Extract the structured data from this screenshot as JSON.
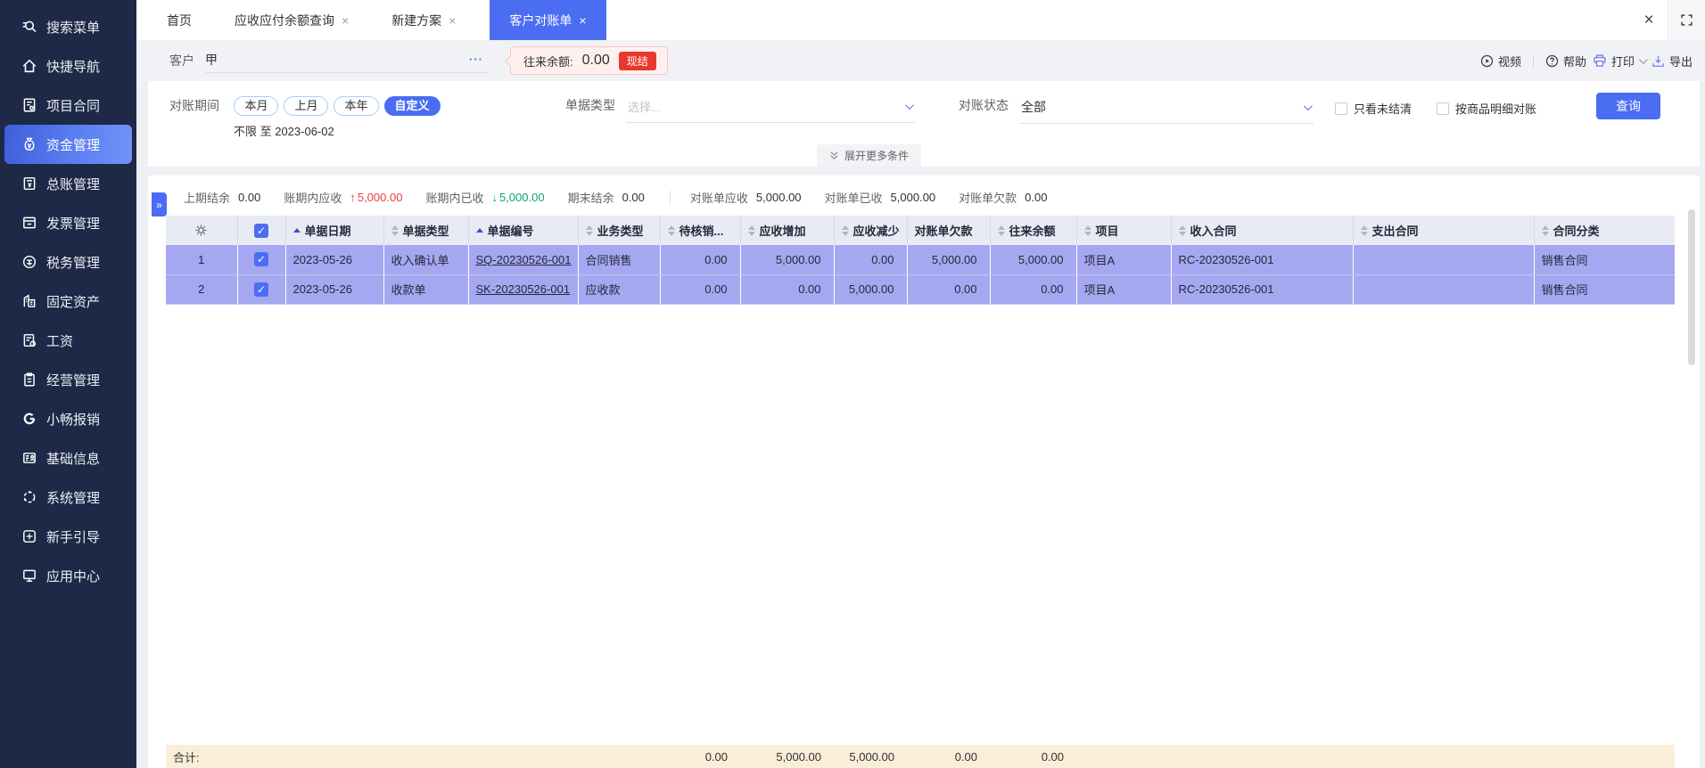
{
  "colors": {
    "accent": "#4a6df2",
    "sidebar_bg": "#1d2946",
    "row_highlight": "#a5a8f0",
    "footer_bg": "#fbeed8",
    "badge_red": "#e8382e",
    "up_red": "#f03e3e",
    "down_green": "#0ca678"
  },
  "sidebar": {
    "items": [
      {
        "label": "搜索菜单",
        "icon": "search-icon"
      },
      {
        "label": "快捷导航",
        "icon": "home-icon"
      },
      {
        "label": "项目合同",
        "icon": "project-contract-icon"
      },
      {
        "label": "资金管理",
        "icon": "funds-icon",
        "active": true
      },
      {
        "label": "总账管理",
        "icon": "ledger-icon"
      },
      {
        "label": "发票管理",
        "icon": "invoice-icon"
      },
      {
        "label": "税务管理",
        "icon": "tax-icon"
      },
      {
        "label": "固定资产",
        "icon": "fixed-assets-icon"
      },
      {
        "label": "工资",
        "icon": "payroll-icon"
      },
      {
        "label": "经营管理",
        "icon": "business-icon"
      },
      {
        "label": "小畅报销",
        "icon": "expense-icon"
      },
      {
        "label": "基础信息",
        "icon": "base-info-icon"
      },
      {
        "label": "系统管理",
        "icon": "system-icon"
      },
      {
        "label": "新手引导",
        "icon": "guide-icon"
      },
      {
        "label": "应用中心",
        "icon": "app-center-icon"
      }
    ]
  },
  "tabbar": {
    "tabs": [
      {
        "label": "首页",
        "closable": false
      },
      {
        "label": "应收应付余额查询",
        "closable": true
      },
      {
        "label": "新建方案",
        "closable": true
      },
      {
        "label": "客户对账单",
        "closable": true,
        "active": true
      }
    ]
  },
  "header": {
    "customer_label": "客户",
    "customer_value": "甲",
    "more_ellipsis": "···",
    "balance_label": "往来余额:",
    "balance_value": "0.00",
    "settle_badge": "现结",
    "video_label": "视频",
    "help_label": "帮助",
    "print_label": "打印",
    "export_label": "导出"
  },
  "filters": {
    "period_label": "对账期间",
    "period_options": [
      "本月",
      "上月",
      "本年",
      "自定义"
    ],
    "period_selected": "自定义",
    "period_range": "不限 至 2023-06-02",
    "doc_type_label": "单据类型",
    "doc_type_placeholder": "选择...",
    "status_label": "对账状态",
    "status_value": "全部",
    "only_unsettled_label": "只看未结清",
    "by_product_label": "按商品明细对账",
    "query_button": "查询",
    "expand_more": "展开更多条件"
  },
  "summary": {
    "prev_balance_label": "上期结余",
    "prev_balance": "0.00",
    "period_receivable_label": "账期内应收",
    "period_receivable": "5,000.00",
    "period_received_label": "账期内已收",
    "period_received": "5,000.00",
    "end_balance_label": "期末结余",
    "end_balance": "0.00",
    "stmt_receivable_label": "对账单应收",
    "stmt_receivable": "5,000.00",
    "stmt_received_label": "对账单已收",
    "stmt_received": "5,000.00",
    "stmt_due_label": "对账单欠款",
    "stmt_due": "0.00"
  },
  "table": {
    "columns": {
      "date": "单据日期",
      "type": "单据类型",
      "no": "单据编号",
      "biz": "业务类型",
      "pending": "待核销...",
      "ar_inc": "应收增加",
      "ar_dec": "应收减少",
      "stmt_due": "对账单欠款",
      "balance": "往来余额",
      "project": "项目",
      "income_contract": "收入合同",
      "expense_contract": "支出合同",
      "category": "合同分类"
    },
    "rows": [
      {
        "num": "1",
        "date": "2023-05-26",
        "type": "收入确认单",
        "no": "SQ-20230526-001",
        "biz": "合同销售",
        "pending": "0.00",
        "ar_inc": "5,000.00",
        "ar_dec": "0.00",
        "stmt_due": "5,000.00",
        "balance": "5,000.00",
        "project": "项目A",
        "income_contract": "RC-20230526-001",
        "expense_contract": "",
        "category": "销售合同"
      },
      {
        "num": "2",
        "date": "2023-05-26",
        "type": "收款单",
        "no": "SK-20230526-001",
        "biz": "应收款",
        "pending": "0.00",
        "ar_inc": "0.00",
        "ar_dec": "5,000.00",
        "stmt_due": "0.00",
        "balance": "0.00",
        "project": "项目A",
        "income_contract": "RC-20230526-001",
        "expense_contract": "",
        "category": "销售合同"
      }
    ],
    "footer": {
      "label": "合计:",
      "pending": "0.00",
      "ar_inc": "5,000.00",
      "ar_dec": "5,000.00",
      "stmt_due": "0.00",
      "balance": "0.00"
    }
  }
}
